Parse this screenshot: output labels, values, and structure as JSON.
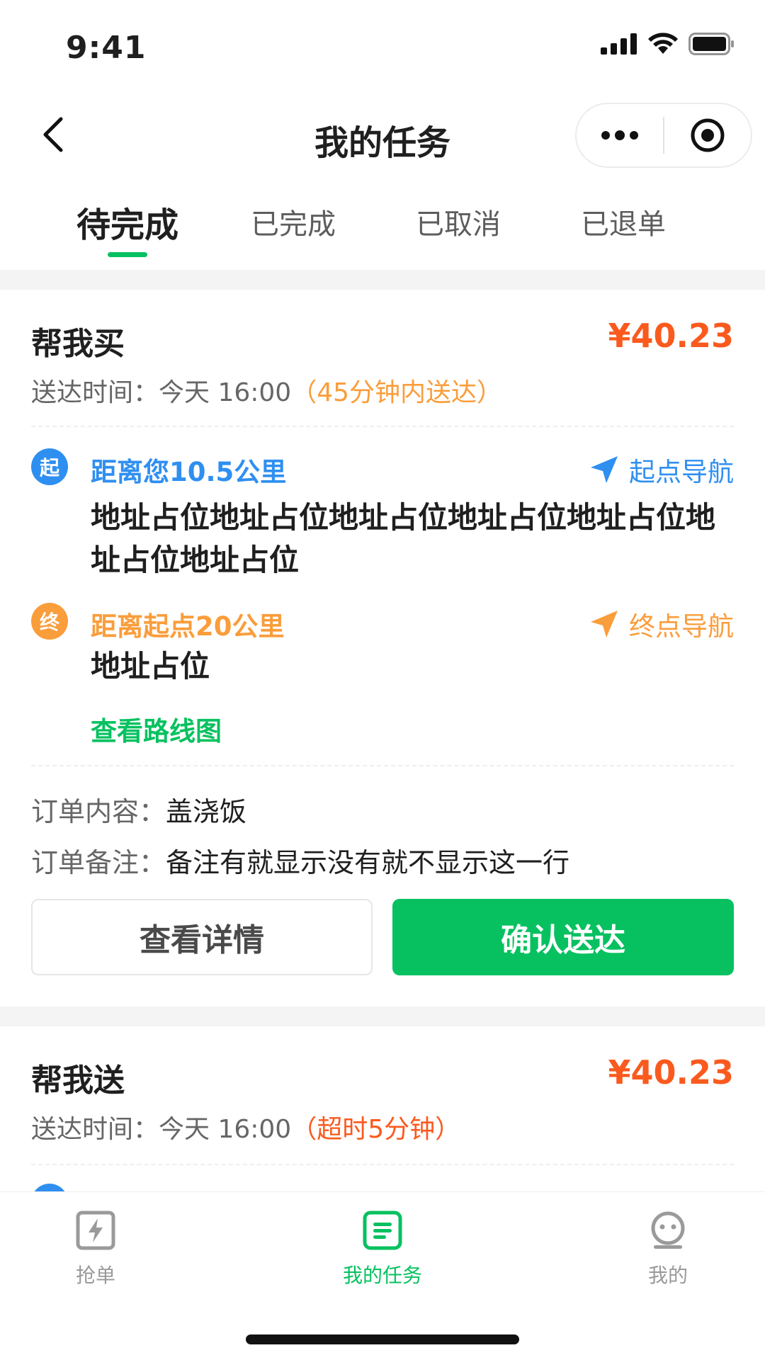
{
  "status_bar": {
    "time": "9:41"
  },
  "nav": {
    "title": "我的任务"
  },
  "tabs": [
    {
      "label": "待完成",
      "active": true
    },
    {
      "label": "已完成",
      "active": false
    },
    {
      "label": "已取消",
      "active": false
    },
    {
      "label": "已退单",
      "active": false
    }
  ],
  "orders": [
    {
      "type": "帮我买",
      "price": "¥40.23",
      "time_label": "送达时间：",
      "time_value": "今天 16:00",
      "time_note": "（45分钟内送达）",
      "start": {
        "badge": "起",
        "distance": "距离您10.5公里",
        "nav_label": "起点导航",
        "address": "地址占位地址占位地址占位地址占位地址占位地址占位地址占位"
      },
      "end": {
        "badge": "终",
        "distance": "距离起点20公里",
        "nav_label": "终点导航",
        "address": "地址占位"
      },
      "route_link": "查看路线图",
      "content_label": "订单内容：",
      "content_value": "盖浇饭",
      "remark_label": "订单备注：",
      "remark_value": "备注有就显示没有就不显示这一行",
      "detail_button": "查看详情",
      "confirm_button": "确认送达"
    },
    {
      "type": "帮我送",
      "price": "¥40.23",
      "time_label": "送达时间：",
      "time_value": "今天 16:00",
      "time_note": "（超时5分钟）"
    }
  ],
  "tabbar": [
    {
      "label": "抢单",
      "icon": "lightning-icon",
      "active": false
    },
    {
      "label": "我的任务",
      "icon": "task-list-icon",
      "active": true
    },
    {
      "label": "我的",
      "icon": "profile-face-icon",
      "active": false
    }
  ],
  "colors": {
    "accent": "#07c160",
    "price": "#fa5a1e",
    "warning": "#fa9d3b",
    "info": "#2f8ff0"
  }
}
